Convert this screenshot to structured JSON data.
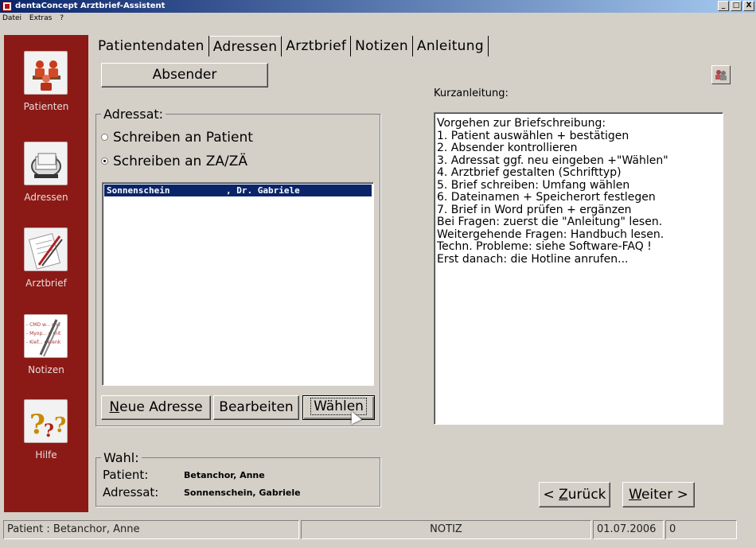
{
  "window": {
    "title": "dentaConcept Arztbrief-Assistent",
    "controls": [
      "_",
      "□",
      "X"
    ]
  },
  "menu": [
    "Datei",
    "Extras",
    "?"
  ],
  "sidebar": {
    "items": [
      {
        "label": "Patienten",
        "icon": "patients-icon"
      },
      {
        "label": "Adressen",
        "icon": "rolodex-icon"
      },
      {
        "label": "Arztbrief",
        "icon": "letter-pen-icon"
      },
      {
        "label": "Notizen",
        "icon": "notes-icon",
        "icon_lines": [
          "- CMD w... che",
          "- Myop... e mit",
          "- Kief... gefenk"
        ]
      },
      {
        "label": "Hilfe",
        "icon": "question-marks-icon"
      }
    ]
  },
  "tabs": [
    {
      "label": "Patientendaten",
      "active": false
    },
    {
      "label": "Adressen",
      "active": true
    },
    {
      "label": "Arztbrief",
      "active": false
    },
    {
      "label": "Notizen",
      "active": false
    },
    {
      "label": "Anleitung",
      "active": false
    }
  ],
  "absender_button": "Absender",
  "adressat": {
    "legend": "Adressat:",
    "options": [
      {
        "label": "Schreiben an Patient",
        "selected": false
      },
      {
        "label": "Schreiben an ZA/ZÄ",
        "selected": true
      }
    ],
    "list": [
      {
        "name": "Sonnenschein",
        "detail": ", Dr. Gabriele",
        "selected": true
      }
    ],
    "buttons": {
      "new_mnemonic": "N",
      "new_rest": "eue Adresse",
      "edit": "Bearbeiten",
      "choose": "Wählen"
    }
  },
  "wahl": {
    "legend": "Wahl:",
    "patient_label": "Patient:",
    "patient_value": "Betanchor, Anne",
    "adressat_label": "Adressat:",
    "adressat_value": "Sonnenschein, Gabriele"
  },
  "kurzanleitung": {
    "label": "Kurzanleitung:",
    "lines": [
      "Vorgehen zur Briefschreibung:",
      "1. Patient auswählen + bestätigen",
      "2. Absender kontrollieren",
      "3. Adressat ggf. neu eingeben +\"Wählen\"",
      "4. Arztbrief gestalten (Schrifttyp)",
      "5. Brief schreiben: Umfang wählen",
      "6. Dateinamen + Speicherort festlegen",
      "7. Brief in Word prüfen + ergänzen",
      "Bei Fragen: zuerst die \"Anleitung\" lesen.",
      "Weitergehende Fragen: Handbuch lesen.",
      "Techn. Probleme: siehe Software-FAQ !",
      "Erst danach: die Hotline anrufen..."
    ]
  },
  "nav": {
    "back_prefix": "< ",
    "back_mnemonic": "Z",
    "back_rest": "urück",
    "next_mnemonic": "W",
    "next_rest": "eiter >"
  },
  "status": {
    "patient": "Patient : Betanchor, Anne",
    "mode": "NOTIZ",
    "date": "01.07.2006",
    "count": "0"
  }
}
